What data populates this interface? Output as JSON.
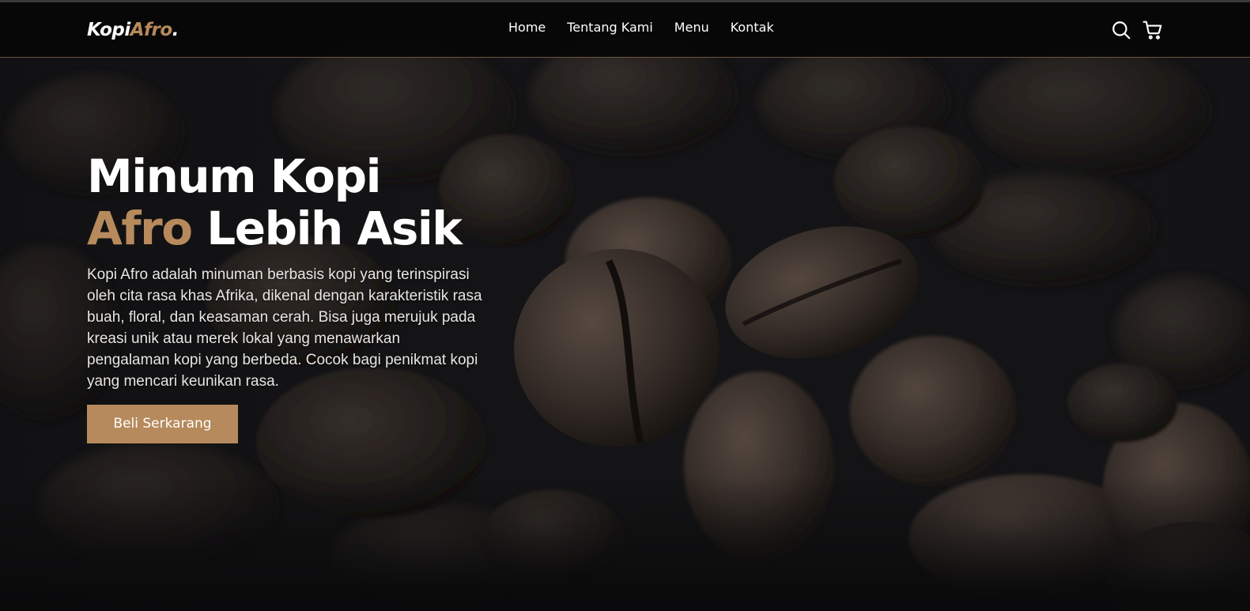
{
  "brand": {
    "logo_main": "Kopi",
    "logo_accent": "Afro",
    "logo_dot": ".",
    "accent_color": "#b68a5c"
  },
  "nav": {
    "items": [
      "Home",
      "Tentang Kami",
      "Menu",
      "Kontak"
    ]
  },
  "icons": {
    "search": "search-icon",
    "cart": "shopping-cart-icon"
  },
  "hero": {
    "title_line1": "Minum Kopi",
    "title_accent": "Afro",
    "title_rest": " Lebih Asik",
    "description": "Kopi Afro adalah minuman berbasis kopi yang terinspirasi oleh cita rasa khas Afrika, dikenal dengan karakteristik rasa buah, floral, dan keasaman cerah. Bisa juga merujuk pada kreasi unik atau merek lokal yang menawarkan pengalaman kopi yang berbeda. Cocok bagi penikmat kopi yang mencari keunikan rasa.",
    "cta_label": "Beli Serkarang"
  }
}
